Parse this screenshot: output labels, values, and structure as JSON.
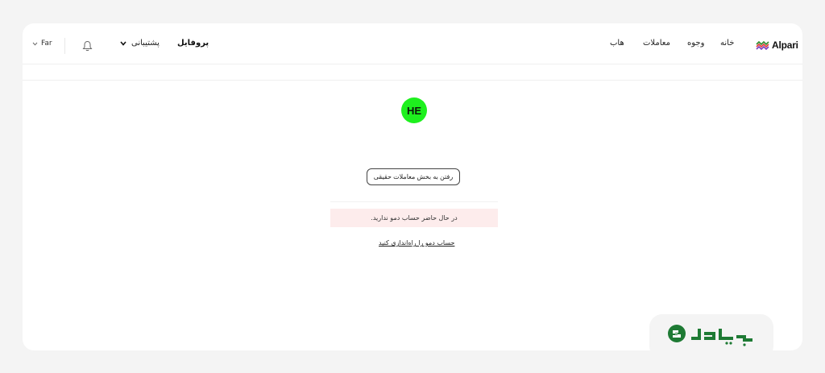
{
  "header": {
    "logo": {
      "text": "Alpari",
      "icon": "alpari-wave-logo-icon"
    },
    "nav": [
      {
        "label": "خانه"
      },
      {
        "label": "وجوه"
      },
      {
        "label": "معاملات"
      },
      {
        "label": "هاب"
      }
    ],
    "profile_label": "پروفایل",
    "support_label": "پشتیبانی",
    "language_label": "Far"
  },
  "main": {
    "avatar_initials": "HE",
    "avatar_color": "#1ef01e",
    "real_trading_button": "رفتن به بخش معاملات حقیقی",
    "demo_alert": "در حال حاضر حساب دمو ندارید.",
    "setup_demo_link": "حساب دمو را راه‌اندازی کنید"
  },
  "watermark": {
    "brand_icon": "sodoup-logo-icon",
    "caption": "SODOUP"
  }
}
